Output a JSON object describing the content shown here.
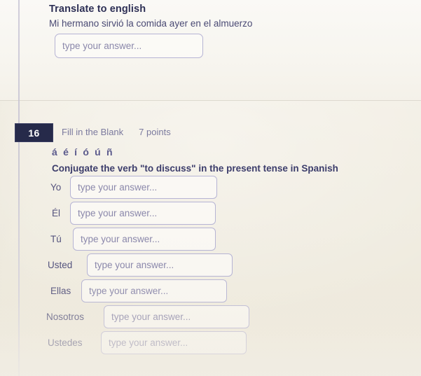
{
  "top_question": {
    "title": "Translate to english",
    "prompt": "Mi hermano sirvió la comida ayer en el almuerzo",
    "answer_placeholder": "type your answer...",
    "answer_value": ""
  },
  "question16": {
    "number": "16",
    "type": "Fill in the Blank",
    "points": "7 points",
    "accent_chars": "á é í ó ú ñ",
    "instruction": "Conjugate the verb \"to discuss\" in the present tense in Spanish",
    "answer_placeholder": "type your answer...",
    "rows": [
      {
        "pronoun": "Yo",
        "value": ""
      },
      {
        "pronoun": "Él",
        "value": ""
      },
      {
        "pronoun": "Tú",
        "value": ""
      },
      {
        "pronoun": "Usted",
        "value": ""
      },
      {
        "pronoun": "Ellas",
        "value": ""
      },
      {
        "pronoun": "Nosotros",
        "value": ""
      },
      {
        "pronoun": "Ustedes",
        "value": ""
      }
    ]
  },
  "colors": {
    "page_background": "#f1ede2",
    "badge_background": "#262a4a",
    "badge_text": "#ffffff",
    "heading_text": "#2d2f55",
    "body_text": "#4a4a74",
    "muted_text": "#7b7a9e",
    "input_border": "#b6b4d4",
    "placeholder_text": "#8b88ab",
    "rail_line": "#c9c6d6",
    "divider": "#ddd9cf"
  }
}
